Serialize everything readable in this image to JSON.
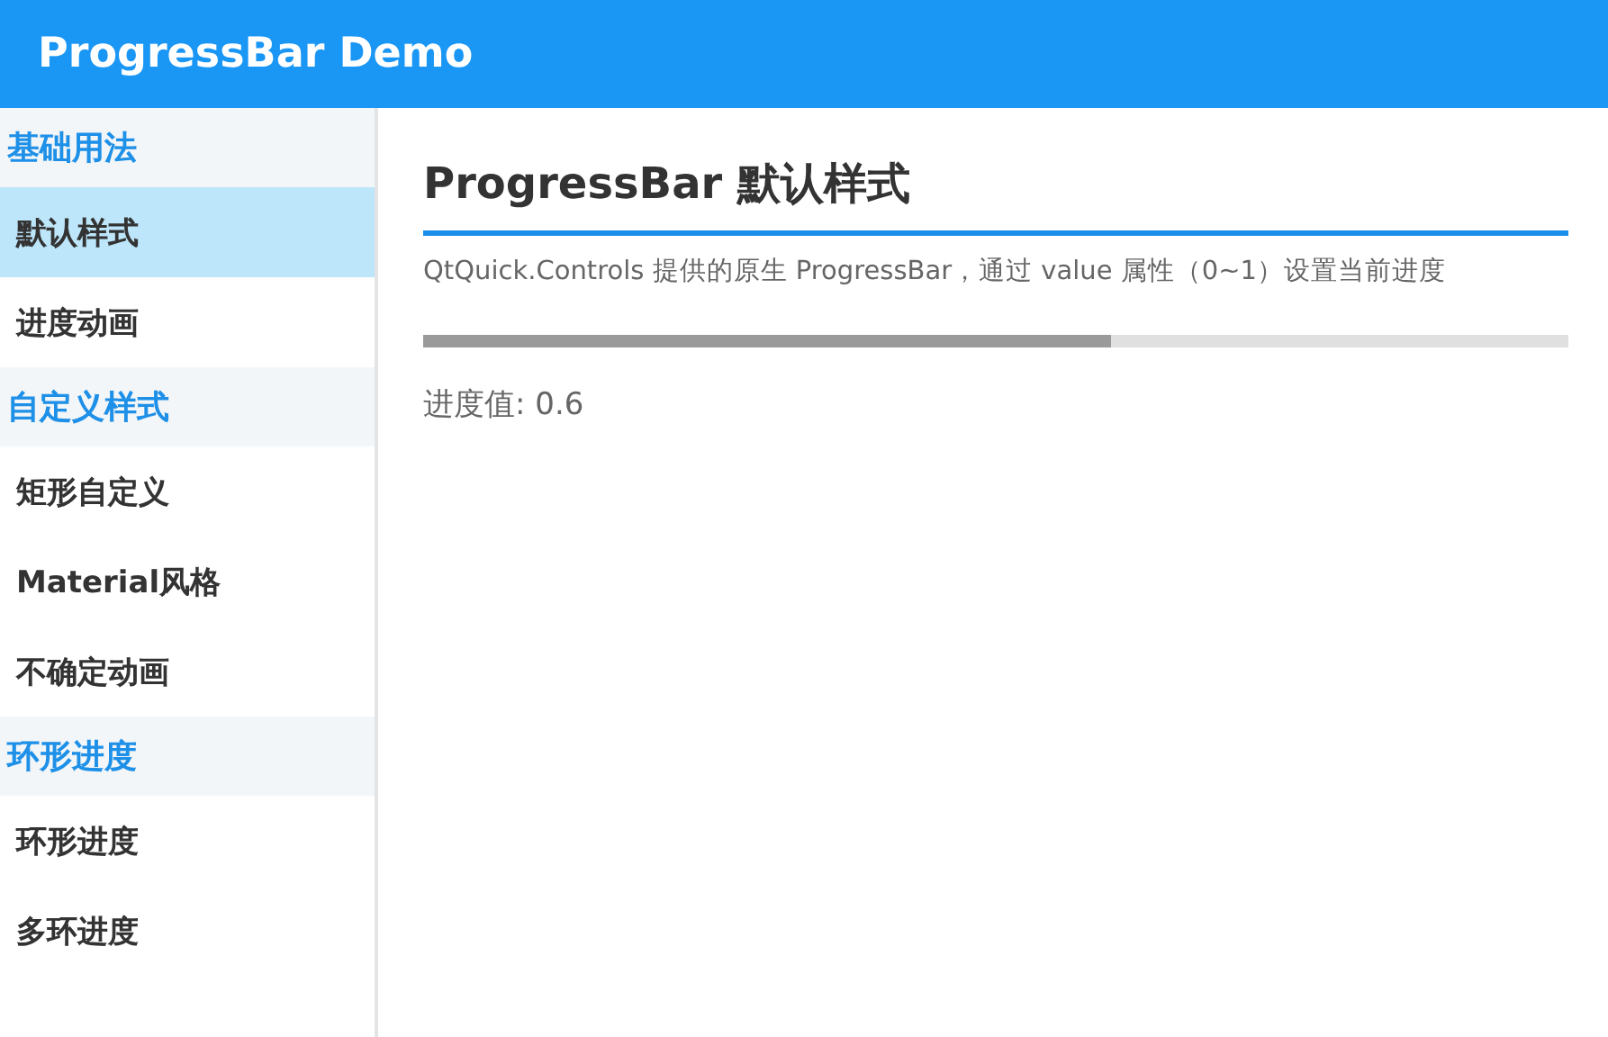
{
  "header": {
    "title": "ProgressBar Demo"
  },
  "sidebar": {
    "groups": [
      {
        "title": "基础用法",
        "items": [
          {
            "label": "默认样式",
            "selected": true
          },
          {
            "label": "进度动画",
            "selected": false
          }
        ]
      },
      {
        "title": "自定义样式",
        "items": [
          {
            "label": "矩形自定义",
            "selected": false
          },
          {
            "label": "Material风格",
            "selected": false
          },
          {
            "label": "不确定动画",
            "selected": false
          }
        ]
      },
      {
        "title": "环形进度",
        "items": [
          {
            "label": "环形进度",
            "selected": false
          },
          {
            "label": "多环进度",
            "selected": false
          }
        ]
      }
    ]
  },
  "content": {
    "title": "ProgressBar 默认样式",
    "description": "QtQuick.Controls 提供的原生 ProgressBar，通过 value 属性（0~1）设置当前进度",
    "progress": {
      "level": 0.6
    },
    "value_label": "进度值: 0.6"
  }
}
